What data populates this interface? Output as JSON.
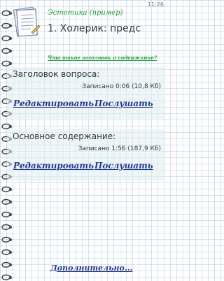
{
  "status_bar": {
    "time": "11:26"
  },
  "header": {
    "subtitle": "Эстетика (пример)",
    "title": "1. Холерик: предс"
  },
  "help_link": "Что такое заголовок и содержание?",
  "sections": [
    {
      "header": "Заголовок вопроса:",
      "status": "Записано 0:06 (10,8 Кб)",
      "edit_label": "Редактировать",
      "listen_label": "Послушать"
    },
    {
      "header": "Основное содержание:",
      "status": "Записано 1:56 (187,9 Кб)",
      "edit_label": "Редактировать",
      "listen_label": "Послушать"
    }
  ],
  "more_link": "Дополнительно...",
  "icons": {
    "notebook": "notebook-icon",
    "spiral": "spiral-ring-icon"
  },
  "colors": {
    "subtitle_green": "#19a33a",
    "link_blue": "#223a98",
    "panel_bg": "#e1eef1",
    "text_dark": "#2f3940"
  }
}
